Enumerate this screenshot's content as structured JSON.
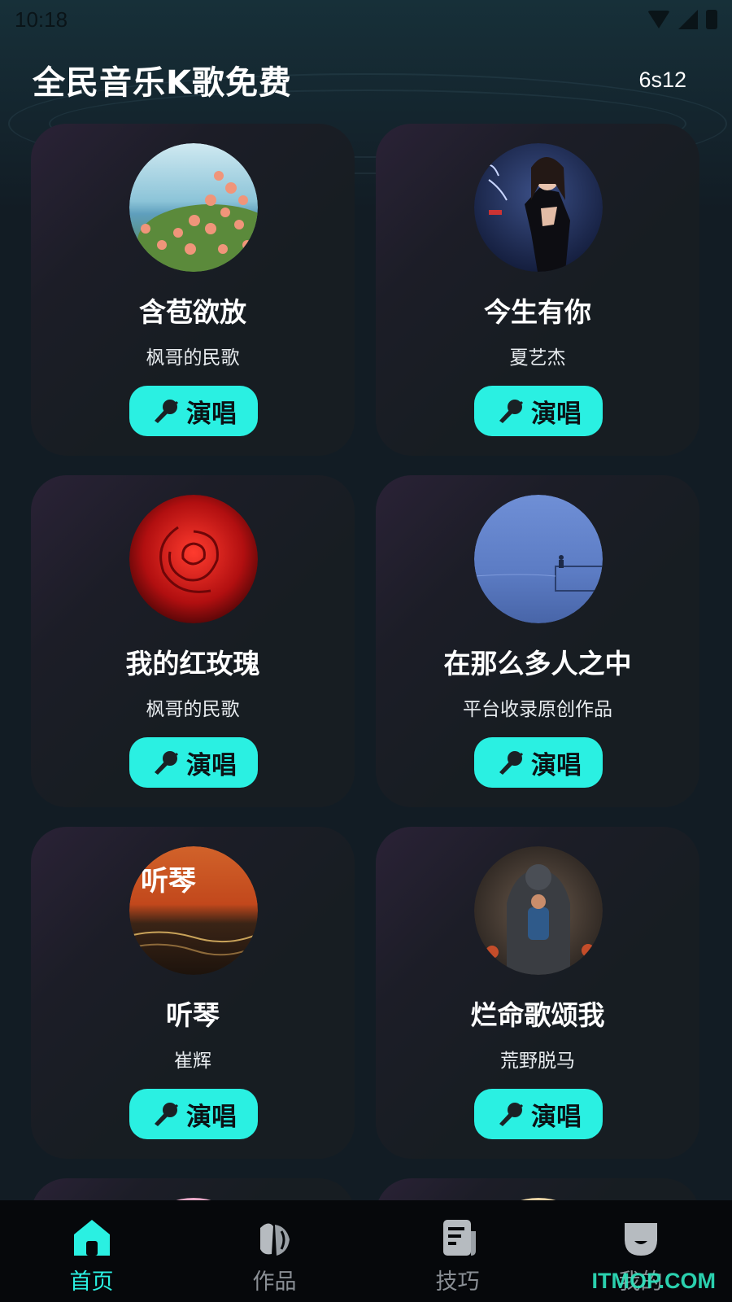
{
  "status_bar": {
    "time": "10:18"
  },
  "header": {
    "title": "全民音乐K歌免费",
    "version": "6s12"
  },
  "songs": [
    {
      "title": "含苞欲放",
      "artist": "枫哥的民歌",
      "button": "演唱",
      "cover": "roses-by-sea"
    },
    {
      "title": "今生有你",
      "artist": "夏艺杰",
      "button": "演唱",
      "cover": "singer-portrait"
    },
    {
      "title": "我的红玫瑰",
      "artist": "枫哥的民歌",
      "button": "演唱",
      "cover": "red-rose"
    },
    {
      "title": "在那么多人之中",
      "artist": "平台收录原创作品",
      "button": "演唱",
      "cover": "blue-sky-figure"
    },
    {
      "title": "听琴",
      "artist": "崔辉",
      "button": "演唱",
      "cover": "tingqin-sunset"
    },
    {
      "title": "烂命歌颂我",
      "artist": "荒野脱马",
      "button": "演唱",
      "cover": "robot-and-child"
    }
  ],
  "cover_art_text": {
    "tingqin": "听琴"
  },
  "bottom_nav": [
    {
      "label": "首页",
      "icon": "home-icon",
      "active": true
    },
    {
      "label": "作品",
      "icon": "works-icon",
      "active": false
    },
    {
      "label": "技巧",
      "icon": "tips-icon",
      "active": false
    },
    {
      "label": "我的",
      "icon": "profile-icon",
      "active": false
    }
  ],
  "watermark": "ITMOP.COM",
  "colors": {
    "accent": "#2af0e2",
    "background": "#121c24",
    "card": "#171d22",
    "nav": "#06080b"
  }
}
